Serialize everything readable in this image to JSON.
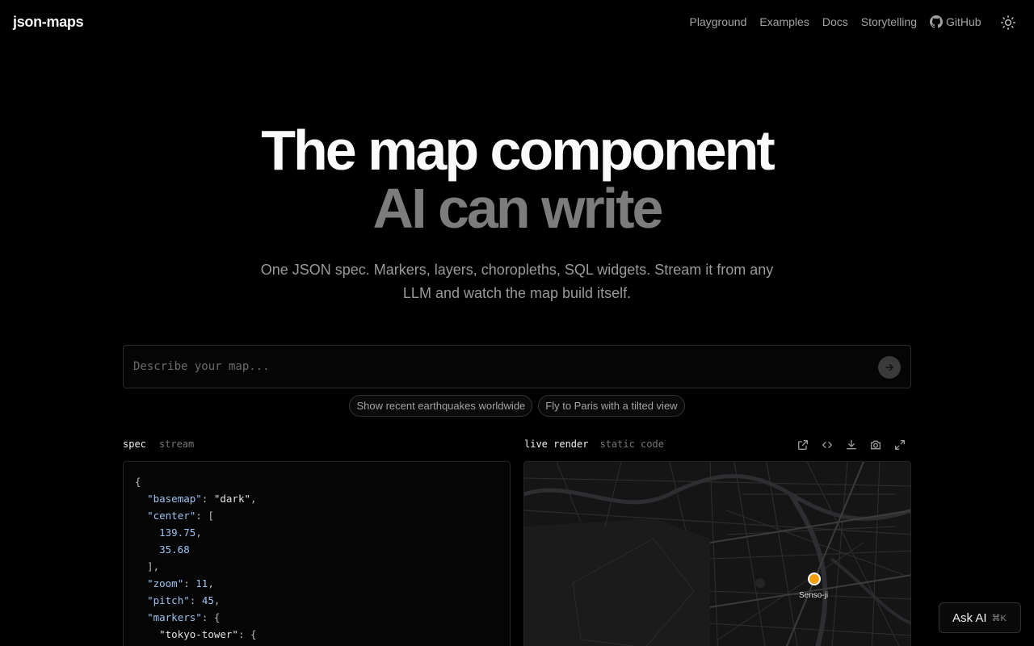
{
  "header": {
    "brand": "json-maps",
    "nav": [
      "Playground",
      "Examples",
      "Docs",
      "Storytelling"
    ],
    "github_label": "GitHub"
  },
  "hero": {
    "title_line1": "The map component",
    "title_line2": "AI can write",
    "subtitle": "One JSON spec. Markers, layers, choropleths, SQL widgets. Stream it from any LLM and watch the map build itself."
  },
  "prompt": {
    "placeholder": "Describe your map..."
  },
  "suggestions": [
    "Show recent earthquakes worldwide",
    "Fly to Paris with a tilted view"
  ],
  "left_tabs": {
    "spec": "spec",
    "stream": "stream"
  },
  "right_tabs": {
    "live": "live render",
    "static": "static code"
  },
  "code": {
    "l1": "{",
    "k_basemap": "\"basemap\"",
    "v_basemap": "\"dark\"",
    "k_center": "\"center\"",
    "v_lng": "139.75",
    "v_lat": "35.68",
    "k_zoom": "\"zoom\"",
    "v_zoom": "11",
    "k_pitch": "\"pitch\"",
    "v_pitch": "45",
    "k_markers": "\"markers\"",
    "k_tower": "\"tokyo-tower\""
  },
  "map": {
    "marker_label": "Senso-ji",
    "marker_color": "#f59e0b"
  },
  "ask_ai": {
    "label": "Ask AI",
    "shortcut": "⌘K"
  }
}
